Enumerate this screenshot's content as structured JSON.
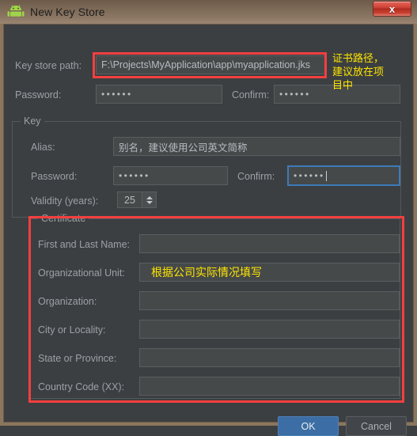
{
  "window": {
    "title": "New Key Store",
    "icon": "android-robot-icon",
    "close_label": "x",
    "frame_color": "#8a755e",
    "body_bg": "#3c3f41"
  },
  "keystore": {
    "path_label": "Key store path:",
    "path_value": "F:\\Projects\\MyApplication\\app\\myapplication.jks",
    "password_label": "Password:",
    "password_value": "••••••",
    "confirm_label": "Confirm:",
    "confirm_value": "••••••"
  },
  "key_group": {
    "title": "Key",
    "alias_label": "Alias:",
    "alias_value": "别名，建议使用公司英文简称",
    "password_label": "Password:",
    "password_value": "••••••",
    "confirm_label": "Confirm:",
    "confirm_value": "••••••",
    "validity_label": "Validity (years):",
    "validity_value": "25"
  },
  "certificate_group": {
    "title": "Certificate",
    "fields": [
      {
        "label": "First and Last Name:",
        "value": ""
      },
      {
        "label": "Organizational Unit:",
        "value": ""
      },
      {
        "label": "Organization:",
        "value": ""
      },
      {
        "label": "City or Locality:",
        "value": ""
      },
      {
        "label": "State or Province:",
        "value": ""
      },
      {
        "label": "Country Code (XX):",
        "value": ""
      }
    ]
  },
  "annotations": {
    "color_box": "#f43f3f",
    "color_text": "#ffe600",
    "path_note": "证书路径，\n建议放在项\n目中",
    "certificate_note": "根据公司实际情况填写"
  },
  "buttons": {
    "ok": "OK",
    "cancel": "Cancel",
    "ok_color": "#3c6ea5"
  }
}
